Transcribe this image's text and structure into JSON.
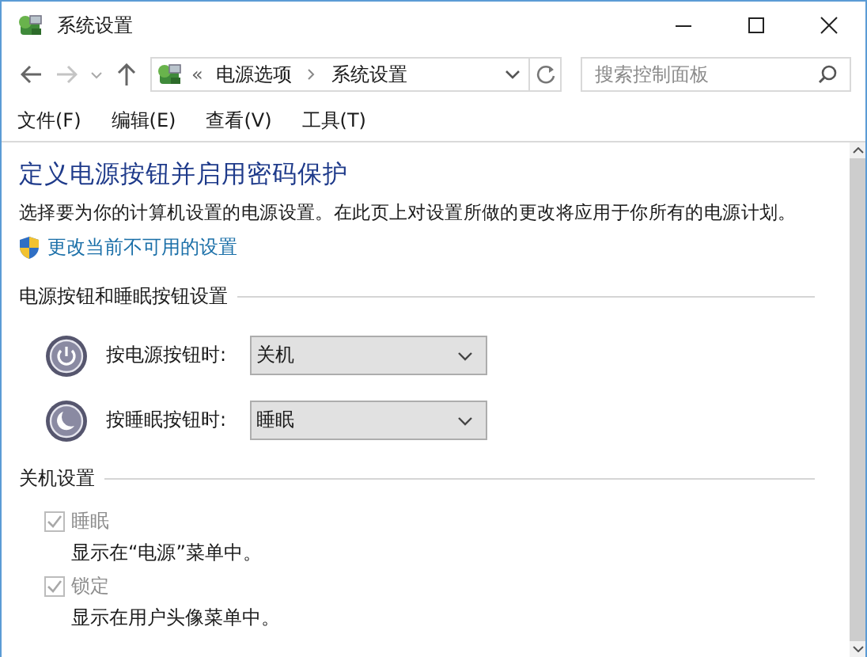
{
  "window": {
    "title": "系统设置"
  },
  "address_bar": {
    "overflow": "«",
    "crumbs": [
      "电源选项",
      "系统设置"
    ]
  },
  "search": {
    "placeholder": "搜索控制面板"
  },
  "menu": [
    "文件(F)",
    "编辑(E)",
    "查看(V)",
    "工具(T)"
  ],
  "page": {
    "heading": "定义电源按钮并启用密码保护",
    "description": "选择要为你的计算机设置的电源设置。在此页上对设置所做的更改将应用于你所有的电源计划。",
    "admin_link": "更改当前不可用的设置"
  },
  "button_section": {
    "title": "电源按钮和睡眠按钮设置",
    "rows": [
      {
        "kind": "power",
        "label": "按电源按钮时:",
        "value": "关机"
      },
      {
        "kind": "sleep",
        "label": "按睡眠按钮时:",
        "value": "睡眠"
      }
    ]
  },
  "shutdown_section": {
    "title": "关机设置",
    "options": [
      {
        "label": "睡眠",
        "description": "显示在“电源”菜单中。",
        "checked": true,
        "disabled": true
      },
      {
        "label": "锁定",
        "description": "显示在用户头像菜单中。",
        "checked": true,
        "disabled": true
      }
    ]
  }
}
